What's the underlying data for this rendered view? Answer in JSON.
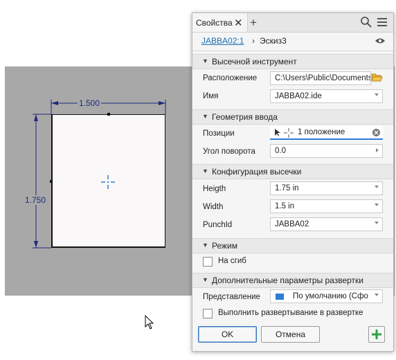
{
  "sketch": {
    "width_dim": "1.500",
    "height_dim": "1.750"
  },
  "panel": {
    "tab_title": "Свойства",
    "breadcrumb_link": "JABBA02:1",
    "breadcrumb_separator": "›",
    "breadcrumb_current": "Эскиз3",
    "sections": {
      "punch_tool": "Высечной инструмент",
      "input_geometry": "Геометрия ввода",
      "punch_config": "Конфигурация высечки",
      "mode": "Режим",
      "advanced": "Дополнительные параметры развертки"
    },
    "fields": {
      "location_label": "Расположение",
      "location_value": "C:\\Users\\Public\\Documents\\",
      "name_label": "Имя",
      "name_value": "JABBA02.ide",
      "positions_label": "Позиции",
      "positions_value": "1 положение",
      "rotation_label": "Угол поворота",
      "rotation_value": "0.0",
      "height_label": "Heigth",
      "height_value": "1.75 in",
      "width_label": "Width",
      "width_value": "1.5 in",
      "punchid_label": "PunchId",
      "punchid_value": "JABBA02",
      "fold_label": "На сгиб",
      "representation_label": "Представление",
      "representation_value": "По умолчанию (Сфо",
      "unfold_label": "Выполнить развертывание в развертке"
    },
    "buttons": {
      "ok": "OK",
      "cancel": "Отмена"
    }
  },
  "colors": {
    "link": "#1b6fb5",
    "accent_blue": "#2d7dd2",
    "dimension": "#1e2a7a",
    "add_green": "#2ea043"
  }
}
